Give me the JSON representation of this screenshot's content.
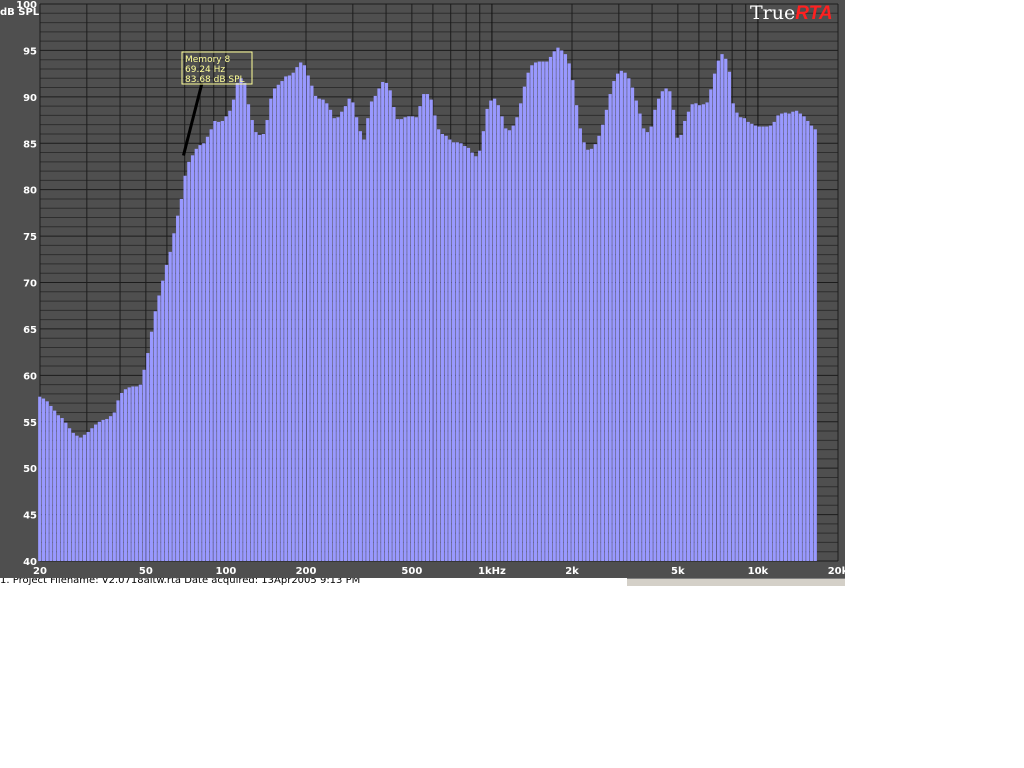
{
  "chart_data": {
    "type": "bar",
    "title": "",
    "ylabel": "dB SPL",
    "xlabel": "",
    "x_scale": "log",
    "xlim": [
      20,
      20000
    ],
    "ylim": [
      40,
      100
    ],
    "x_ticks": [
      {
        "value": 20,
        "label": "20"
      },
      {
        "value": 50,
        "label": "50"
      },
      {
        "value": 100,
        "label": "100"
      },
      {
        "value": 200,
        "label": "200"
      },
      {
        "value": 500,
        "label": "500"
      },
      {
        "value": 1000,
        "label": "1kHz"
      },
      {
        "value": 2000,
        "label": "2k"
      },
      {
        "value": 5000,
        "label": "5k"
      },
      {
        "value": 10000,
        "label": "10k"
      },
      {
        "value": 20000,
        "label": "20k"
      }
    ],
    "y_ticks": [
      40,
      45,
      50,
      55,
      60,
      65,
      70,
      75,
      80,
      85,
      90,
      95,
      100
    ],
    "grid": true,
    "bar_color": "#9999ff",
    "frequencies": [
      20.0,
      20.65,
      21.33,
      22.03,
      22.75,
      23.5,
      24.27,
      25.06,
      25.89,
      26.74,
      27.61,
      28.52,
      29.45,
      30.42,
      31.42,
      32.45,
      33.51,
      34.61,
      35.74,
      36.92,
      38.13,
      39.38,
      40.67,
      42.0,
      43.38,
      44.8,
      46.27,
      47.79,
      49.36,
      50.97,
      52.64,
      54.37,
      56.15,
      58.0,
      59.9,
      61.86,
      63.89,
      65.99,
      68.15,
      70.39,
      72.7,
      75.08,
      77.54,
      80.09,
      82.71,
      85.43,
      88.23,
      91.12,
      94.11,
      97.2,
      100.39,
      103.68,
      107.08,
      110.59,
      114.22,
      117.97,
      121.84,
      125.83,
      129.96,
      134.22,
      138.63,
      143.17,
      147.87,
      152.72,
      157.73,
      162.9,
      168.25,
      173.77,
      179.47,
      185.35,
      191.43,
      197.71,
      204.2,
      210.9,
      217.81,
      224.96,
      232.34,
      239.96,
      247.83,
      255.96,
      264.36,
      273.03,
      281.98,
      291.23,
      300.79,
      310.65,
      320.84,
      331.37,
      342.24,
      353.46,
      365.06,
      377.03,
      389.4,
      402.17,
      415.36,
      428.99,
      443.06,
      457.59,
      472.6,
      488.1,
      504.11,
      520.65,
      537.73,
      555.37,
      573.58,
      592.4,
      611.83,
      631.9,
      652.63,
      674.04,
      696.15,
      718.98,
      742.57,
      766.93,
      792.08,
      818.07,
      844.9,
      872.62,
      901.24,
      930.8,
      961.34,
      992.87,
      1025.44,
      1059.08,
      1093.82,
      1129.7,
      1166.76,
      1205.03,
      1244.56,
      1285.39,
      1327.55,
      1371.1,
      1416.08,
      1462.53,
      1510.5,
      1560.05,
      1611.23,
      1664.08,
      1718.67,
      1775.05,
      1833.28,
      1893.41,
      1955.52,
      2019.67,
      2085.92,
      2154.35,
      2225.02,
      2298.01,
      2373.39,
      2451.25,
      2531.66,
      2614.71,
      2700.48,
      2789.07,
      2880.56,
      2975.05,
      3072.65,
      3173.44,
      3277.54,
      3385.06,
      3496.1,
      3610.78,
      3729.23,
      3851.56,
      3977.91,
      4108.4,
      4243.17,
      4382.36,
      4526.12,
      4674.59,
      4827.93,
      4986.31,
      5149.88,
      5318.81,
      5493.29,
      5673.49,
      5859.6,
      6051.82,
      6250.34,
      6455.37,
      6667.13,
      6885.83,
      7111.72,
      7345.01,
      7585.95,
      7834.8,
      8091.81,
      8357.25,
      8631.4,
      8914.54,
      9206.97,
      9509.0,
      9820.93,
      10143.09,
      10475.82,
      10819.47,
      11174.38,
      11540.94,
      11919.52,
      12310.53,
      12714.37,
      13131.44,
      13562.2,
      14007.09,
      14466.57,
      14941.14,
      15431.27,
      15937.47,
      16460.29,
      17000.25,
      17557.91,
      18133.88,
      18728.73,
      19343.1,
      19977.62
    ],
    "values": [
      57.7,
      57.5,
      57.2,
      56.7,
      56.2,
      55.7,
      55.4,
      54.9,
      54.3,
      53.8,
      53.5,
      53.3,
      53.6,
      53.9,
      54.3,
      54.7,
      55.0,
      55.2,
      55.3,
      55.6,
      56.0,
      57.3,
      58.1,
      58.5,
      58.7,
      58.8,
      58.8,
      59.0,
      60.6,
      62.4,
      64.7,
      66.9,
      68.6,
      70.2,
      71.9,
      73.3,
      75.3,
      77.2,
      79.0,
      81.5,
      83.0,
      83.7,
      84.4,
      84.8,
      85.0,
      85.7,
      86.5,
      87.4,
      87.3,
      87.4,
      87.9,
      88.5,
      89.7,
      91.5,
      92.0,
      91.5,
      89.2,
      87.5,
      86.2,
      85.9,
      86.0,
      87.5,
      89.8,
      90.9,
      91.3,
      91.7,
      92.2,
      92.3,
      92.6,
      93.2,
      93.7,
      93.4,
      92.3,
      91.2,
      90.1,
      89.8,
      89.7,
      89.3,
      88.6,
      87.7,
      87.8,
      88.4,
      89.0,
      89.8,
      89.4,
      87.8,
      86.3,
      85.4,
      87.7,
      89.5,
      90.1,
      90.9,
      91.6,
      91.5,
      90.7,
      88.9,
      87.6,
      87.6,
      87.8,
      87.9,
      87.9,
      87.8,
      89.0,
      90.3,
      90.3,
      89.7,
      88.0,
      86.5,
      86.0,
      85.8,
      85.4,
      85.1,
      85.1,
      85.0,
      84.7,
      84.5,
      84.0,
      83.6,
      84.2,
      86.3,
      88.7,
      89.6,
      89.8,
      89.1,
      87.9,
      86.6,
      86.4,
      86.9,
      87.8,
      89.3,
      91.1,
      92.6,
      93.4,
      93.7,
      93.8,
      93.8,
      93.8,
      94.3,
      94.9,
      95.3,
      95.0,
      94.6,
      93.6,
      91.8,
      89.1,
      86.6,
      85.1,
      84.3,
      84.4,
      84.9,
      85.8,
      87.0,
      88.6,
      90.3,
      91.7,
      92.5,
      92.8,
      92.6,
      92.0,
      91.0,
      89.6,
      88.2,
      86.6,
      86.2,
      86.8,
      88.6,
      89.8,
      90.6,
      90.9,
      90.6,
      88.6,
      85.6,
      85.9,
      87.4,
      88.4,
      89.2,
      89.3,
      89.1,
      89.2,
      89.4,
      90.8,
      92.5,
      93.9,
      94.6,
      94.1,
      92.7,
      89.3,
      88.3,
      87.8,
      87.7,
      87.3,
      87.1,
      86.9,
      86.8,
      86.8,
      86.8,
      86.9,
      87.3,
      88.0,
      88.2,
      88.3,
      88.2,
      88.4,
      88.5,
      88.2,
      87.9,
      87.4,
      86.9,
      86.5
    ]
  },
  "brand": {
    "part1": "True",
    "part2": "RTA",
    "color1": "#ffffff",
    "color2": "#ff2020"
  },
  "annotation": {
    "line1": "Memory 8",
    "line2": "69.24 Hz",
    "line3": "83.68 dB SPL",
    "frequency": 69.24,
    "level": 83.68,
    "color": "#ffff99"
  },
  "status": {
    "text": "1. Project Filename: V2.0718altw.rta Date acquired: 13Apr2005 9:13 PM"
  },
  "colors": {
    "background": "#4f4f4f",
    "grid_major": "#1c1c1c",
    "grid_minor": "#2e2e2e",
    "text": "#ffffff"
  }
}
